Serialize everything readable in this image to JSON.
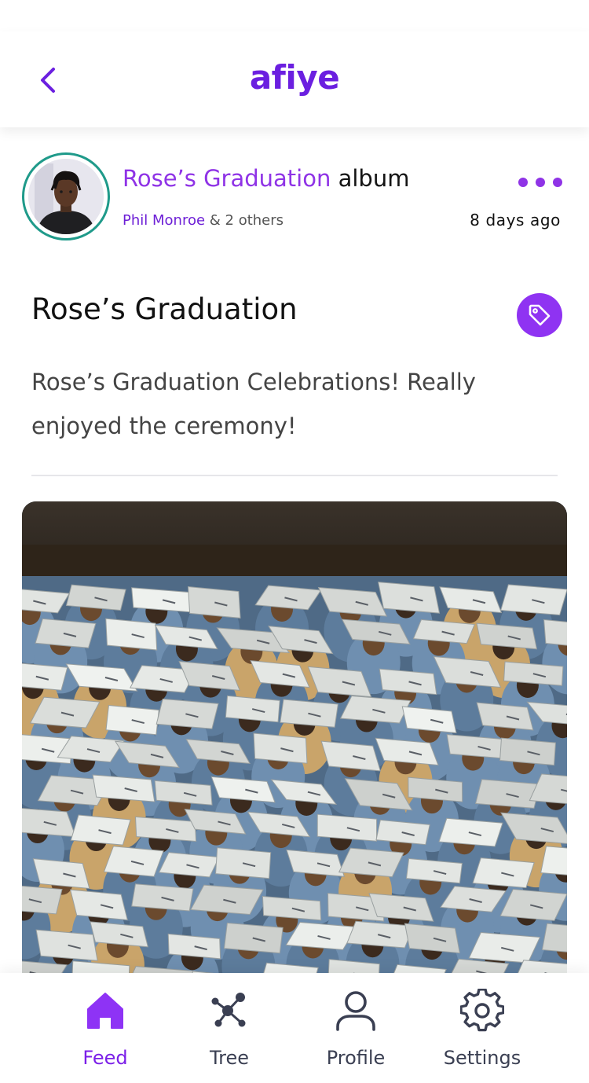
{
  "header": {
    "brand": "afiye",
    "back_icon": "chevron-left-icon"
  },
  "post": {
    "album_name": "Rose’s Graduation",
    "album_word": "album",
    "author": "Phil Monroe",
    "others": "& 2 others",
    "time_ago": "8 days ago",
    "title": "Rose’s Graduation",
    "description": "Rose’s Graduation Celebrations! Really enjoyed the ceremony!",
    "more_icon": "more-dots-icon",
    "tag_icon": "tag-icon"
  },
  "nav": {
    "items": [
      {
        "label": "Feed",
        "icon": "home-icon",
        "active": true
      },
      {
        "label": "Tree",
        "icon": "tree-network-icon",
        "active": false
      },
      {
        "label": "Profile",
        "icon": "user-icon",
        "active": false
      },
      {
        "label": "Settings",
        "icon": "gear-icon",
        "active": false
      }
    ]
  },
  "colors": {
    "accent": "#8f33e6",
    "brand": "#6b1fe0",
    "avatar_ring": "#1f9a8a",
    "nav_inactive": "#3a3f52"
  }
}
